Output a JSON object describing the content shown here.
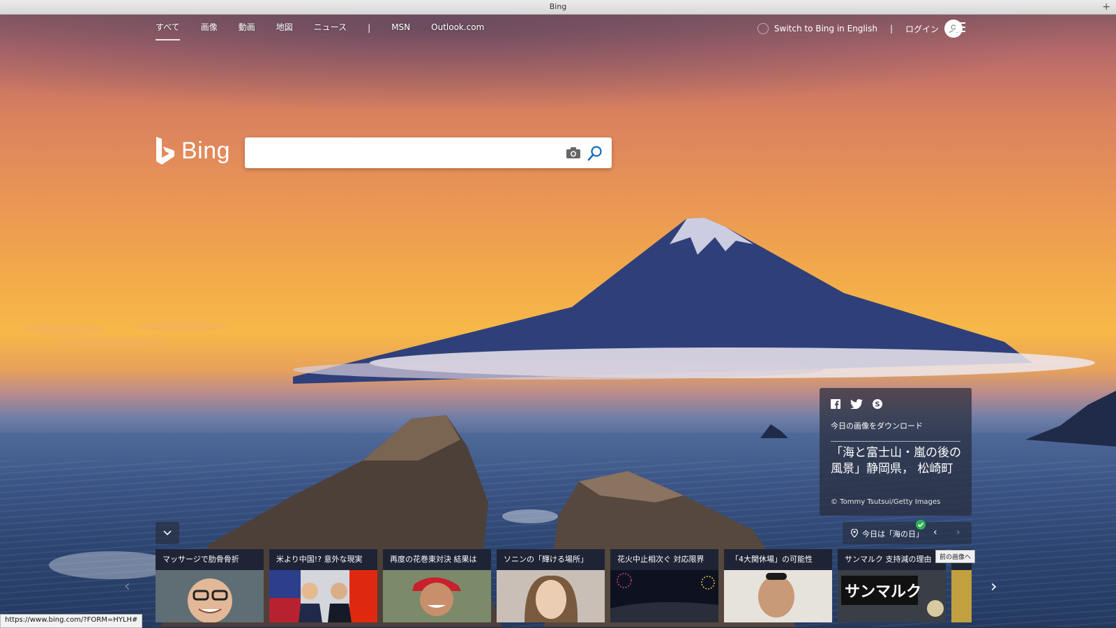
{
  "window": {
    "title": "Bing"
  },
  "nav": {
    "links": [
      "すべて",
      "画像",
      "動画",
      "地図",
      "ニュース"
    ],
    "separator": "|",
    "extra_links": [
      "MSN",
      "Outlook.com"
    ],
    "switch_lang": "Switch to Bing in English",
    "right_sep": "|",
    "login": "ログイン"
  },
  "logo": {
    "text": "Bing"
  },
  "search": {
    "value": "",
    "placeholder": ""
  },
  "image_info": {
    "download": "今日の画像をダウンロード",
    "title": "「海と富士山・嵐の後の風景」静岡県， 松崎町",
    "credit": "© Tommy Tsutsui/Getty Images"
  },
  "day_bar": {
    "text": "今日は「海の日」"
  },
  "tooltip": "前の画像へ",
  "news": [
    {
      "caption": "マッサージで肋骨骨折"
    },
    {
      "caption": "米より中国!? 意外な現実"
    },
    {
      "caption": "再度の花巻東対決 結果は"
    },
    {
      "caption": "ソニンの「輝ける場所」"
    },
    {
      "caption": "花火中止相次ぐ 対応限界"
    },
    {
      "caption": "「4大関休場」の可能性"
    },
    {
      "caption": "サンマルク 支持減の理由"
    },
    {
      "caption": ""
    }
  ],
  "status_url": "https://www.bing.com/?FORM=HYLH#",
  "colors": {
    "accent_blue": "#0f6cbd",
    "check_green": "#2fb153"
  }
}
